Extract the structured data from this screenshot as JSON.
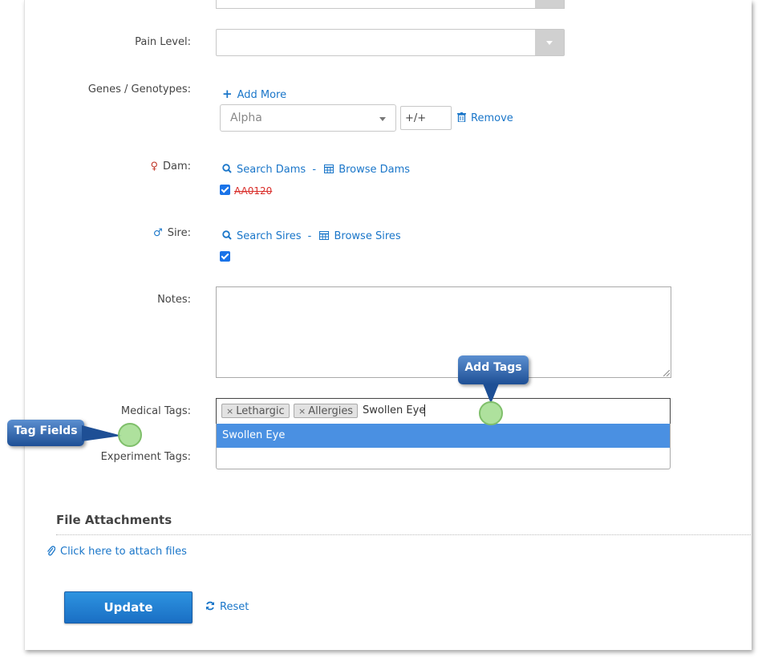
{
  "fields": {
    "pain_level_label": "Pain Level:",
    "genes_label": "Genes / Genotypes:",
    "add_more": "Add More",
    "gene_select_value": "Alpha",
    "genotype_value": "+/+",
    "remove": "Remove",
    "dam_label": "Dam:",
    "search_dams": "Search Dams",
    "browse_dams": "Browse Dams",
    "link_sep": "-",
    "dam_value": "AA0120",
    "sire_label": "Sire:",
    "search_sires": "Search Sires",
    "browse_sires": "Browse Sires",
    "notes_label": "Notes:",
    "medical_tags_label": "Medical Tags:",
    "experiment_tags_label": "Experiment Tags:"
  },
  "medical_tags": {
    "tags": [
      "Lethargic",
      "Allergies"
    ],
    "remove_glyph": "×",
    "input_value": "Swollen Eye",
    "suggestions": [
      "Swollen Eye"
    ]
  },
  "attachments": {
    "section_title": "File Attachments",
    "attach_link": "Click here to attach files"
  },
  "actions": {
    "update": "Update",
    "reset": "Reset"
  },
  "callouts": {
    "add_tags": "Add Tags",
    "tag_fields": "Tag Fields"
  },
  "colors": {
    "link": "#1a76c9",
    "highlight": "#4a90e2",
    "female_icon": "#c0392b"
  }
}
